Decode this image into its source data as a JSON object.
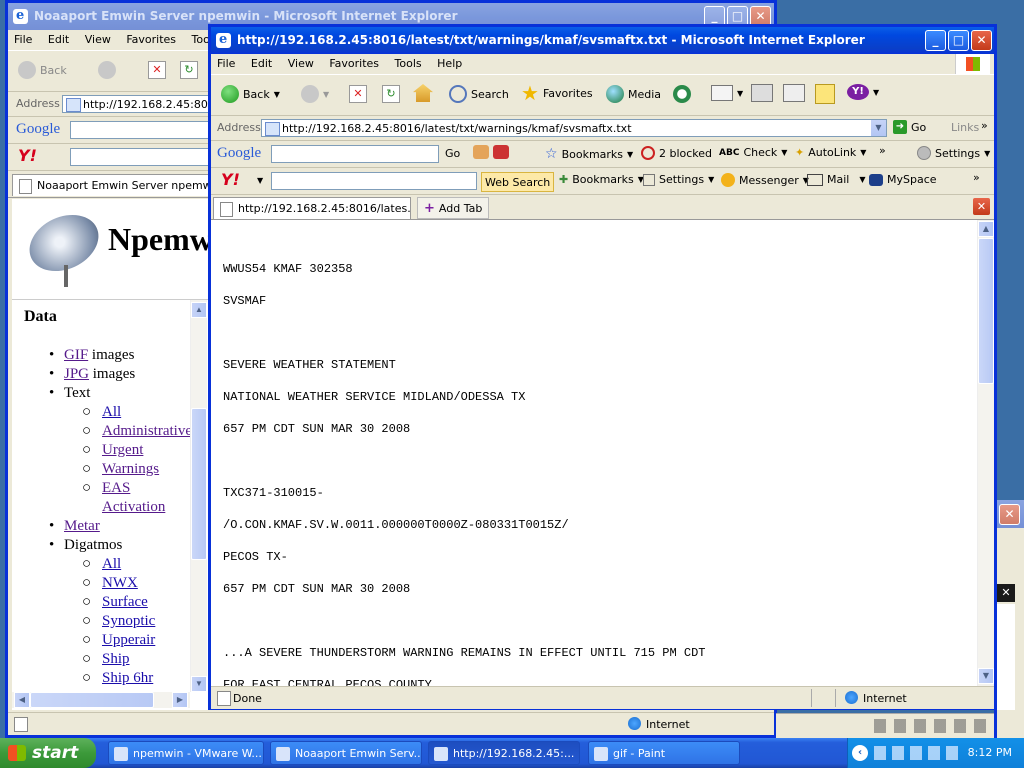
{
  "back_window": {
    "title": "Noaaport Emwin Server npemwin - Microsoft Internet Explorer",
    "menu": [
      "File",
      "Edit",
      "View",
      "Favorites",
      "Tools"
    ],
    "back_label": "Back",
    "address_label": "Address",
    "address_value": "http://192.168.2.45:8016/",
    "tab_label": "Noaaport Emwin Server npemwin",
    "page_heading": "Npemwin",
    "data_heading": "Data",
    "status_zone": "Internet",
    "list": {
      "gif": "GIF",
      "gif_suffix": " images",
      "jpg": "JPG",
      "jpg_suffix": " images",
      "text": "Text",
      "text_items": [
        "All",
        "Administrative",
        "Urgent",
        "Warnings",
        "EAS Activation"
      ],
      "metar": "Metar",
      "digatmos": "Digatmos",
      "digatmos_items": [
        "All",
        "NWX",
        "Surface",
        "Synoptic",
        "Upperair",
        "Ship",
        "Ship 6hr"
      ]
    }
  },
  "front_window": {
    "title": "http://192.168.2.45:8016/latest/txt/warnings/kmaf/svsmaftx.txt - Microsoft Internet Explorer",
    "menu": [
      "File",
      "Edit",
      "View",
      "Favorites",
      "Tools",
      "Help"
    ],
    "toolbar": {
      "back": "Back",
      "search": "Search",
      "favorites": "Favorites",
      "media": "Media"
    },
    "address_label": "Address",
    "address_value": "http://192.168.2.45:8016/latest/txt/warnings/kmaf/svsmaftx.txt",
    "go_label": "Go",
    "links_label": "Links",
    "google_bar": {
      "go": "Go",
      "bookmarks": "Bookmarks",
      "blocked": "2 blocked",
      "check": "Check",
      "autolink": "AutoLink",
      "settings": "Settings"
    },
    "yahoo_bar": {
      "web_search": "Web Search",
      "bookmarks": "Bookmarks",
      "settings": "Settings",
      "messenger": "Messenger",
      "mail": "Mail",
      "myspace": "MySpace"
    },
    "tab_label": "http://192.168.2.45:8016/lates...",
    "add_tab_label": "Add Tab",
    "status_left": "Done",
    "status_zone": "Internet",
    "document_lines": [
      "WWUS54 KMAF 302358",
      "SVSMAF",
      "",
      "SEVERE WEATHER STATEMENT",
      "NATIONAL WEATHER SERVICE MIDLAND/ODESSA TX",
      "657 PM CDT SUN MAR 30 2008",
      "",
      "TXC371-310015-",
      "/O.CON.KMAF.SV.W.0011.000000T0000Z-080331T0015Z/",
      "PECOS TX-",
      "657 PM CDT SUN MAR 30 2008",
      "",
      "...A SEVERE THUNDERSTORM WARNING REMAINS IN EFFECT UNTIL 715 PM CDT",
      "FOR EAST CENTRAL PECOS COUNTY..."
    ]
  },
  "taskbar": {
    "start": "start",
    "tasks": [
      "npemwin - VMware W...",
      "Noaaport Emwin Serv...",
      "http://192.168.2.45:...",
      "gif - Paint"
    ],
    "clock": "8:12 PM"
  }
}
